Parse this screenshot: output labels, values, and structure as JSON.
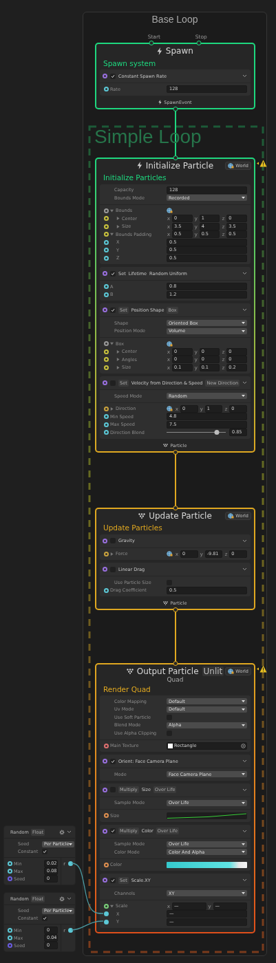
{
  "group": {
    "title": "Base Loop"
  },
  "subgroup": {
    "title": "Simple Loop"
  },
  "contexts": [
    {
      "kind": "spawn",
      "title": "Spawn",
      "inputs": [
        "Start",
        "Stop"
      ],
      "heading": "Spawn system",
      "color": "#1ed87f",
      "warning": false,
      "output": "SpawnEvent",
      "blocks": [
        {
          "checked": true,
          "title": [
            {
              "text": "Constant Spawn Rate",
              "chip": false
            }
          ],
          "sections": [
            [
              {
                "kind": "field",
                "label": "Rate",
                "value": "128",
                "color": "#5cc8d6"
              }
            ]
          ]
        }
      ]
    },
    {
      "kind": "init",
      "title": "Initialize Particle",
      "space": "World",
      "heading": "Initialize Particles",
      "color": "#1ed87f",
      "warning": true,
      "output": "Particle",
      "blocks": [
        {
          "sections": [
            [
              {
                "kind": "field",
                "label": "Capacity",
                "value": "128"
              },
              {
                "kind": "dropdown",
                "label": "Bounds Mode",
                "value": "Recorded"
              }
            ],
            [
              {
                "kind": "spaced",
                "label": "Bounds",
                "expanded": true,
                "color": "#9a9a9a",
                "children": [
                  {
                    "kind": "vector",
                    "label": "Center",
                    "expanded": false,
                    "color": "#c9c23e",
                    "components": [
                      {
                        "axis": "x",
                        "value": "0"
                      },
                      {
                        "axis": "y",
                        "value": "1"
                      },
                      {
                        "axis": "z",
                        "value": "0"
                      }
                    ]
                  },
                  {
                    "kind": "vector",
                    "label": "Size",
                    "expanded": false,
                    "color": "#c9c23e",
                    "components": [
                      {
                        "axis": "x",
                        "value": "3.5"
                      },
                      {
                        "axis": "y",
                        "value": "4"
                      },
                      {
                        "axis": "z",
                        "value": "3.5"
                      }
                    ]
                  }
                ]
              },
              {
                "kind": "vector",
                "label": "Bounds Padding",
                "expanded": true,
                "color": "#c9c23e",
                "components": [
                  {
                    "axis": "x",
                    "value": "0.5"
                  },
                  {
                    "axis": "y",
                    "value": "0.5"
                  },
                  {
                    "axis": "z",
                    "value": "0.5"
                  }
                ],
                "children": [
                  {
                    "kind": "field",
                    "label": "X",
                    "value": "0.5",
                    "color": "#5cc8d6"
                  },
                  {
                    "kind": "field",
                    "label": "Y",
                    "value": "0.5",
                    "color": "#5cc8d6"
                  },
                  {
                    "kind": "field",
                    "label": "Z",
                    "value": "0.5",
                    "color": "#5cc8d6"
                  }
                ]
              }
            ]
          ]
        },
        {
          "checked": true,
          "title": [
            {
              "text": "Set",
              "chip": false
            },
            {
              "text": "Lifetime",
              "chip": false
            },
            {
              "text": "Random Uniform",
              "chip": false
            }
          ],
          "sections": [
            [
              {
                "kind": "field",
                "label": "A",
                "value": "0.8",
                "color": "#5cc8d6"
              },
              {
                "kind": "field",
                "label": "B",
                "value": "1.2",
                "color": "#5cc8d6"
              }
            ]
          ]
        },
        {
          "checked": true,
          "title": [
            {
              "text": "Set",
              "chip": true
            },
            {
              "text": "Position Shape",
              "chip": false
            },
            {
              "text": "Box",
              "chip": true
            }
          ],
          "sections": [
            [
              {
                "kind": "dropdown",
                "label": "Shape",
                "value": "Oriented Box"
              },
              {
                "kind": "dropdown",
                "label": "Position Mode",
                "value": "Volume"
              }
            ],
            [
              {
                "kind": "spaced",
                "label": "Box",
                "expanded": true,
                "color": "#9a9a9a",
                "children": [
                  {
                    "kind": "vector",
                    "label": "Center",
                    "expanded": false,
                    "color": "#c9c23e",
                    "components": [
                      {
                        "axis": "x",
                        "value": "0"
                      },
                      {
                        "axis": "y",
                        "value": "0"
                      },
                      {
                        "axis": "z",
                        "value": "0"
                      }
                    ]
                  },
                  {
                    "kind": "vector",
                    "label": "Angles",
                    "expanded": false,
                    "color": "#c9c23e",
                    "components": [
                      {
                        "axis": "x",
                        "value": "0"
                      },
                      {
                        "axis": "y",
                        "value": "0"
                      },
                      {
                        "axis": "z",
                        "value": "0"
                      }
                    ]
                  },
                  {
                    "kind": "vector",
                    "label": "Size",
                    "expanded": false,
                    "color": "#c9c23e",
                    "components": [
                      {
                        "axis": "x",
                        "value": "0.1"
                      },
                      {
                        "axis": "y",
                        "value": "0.1"
                      },
                      {
                        "axis": "z",
                        "value": "0.2"
                      }
                    ]
                  }
                ]
              }
            ]
          ]
        },
        {
          "checked": false,
          "title": [
            {
              "text": "Set",
              "chip": true
            },
            {
              "text": "Velocity from Direction & Speed",
              "chip": false
            },
            {
              "text": "New Direction",
              "chip": true
            }
          ],
          "sections": [
            [
              {
                "kind": "dropdown",
                "label": "Speed Mode",
                "value": "Random"
              }
            ],
            [
              {
                "kind": "spaced",
                "label": "Direction",
                "expanded": false,
                "color": "#c9a23e",
                "components": [
                  {
                    "axis": "x",
                    "value": "0"
                  },
                  {
                    "axis": "y",
                    "value": "1"
                  },
                  {
                    "axis": "z",
                    "value": "0"
                  }
                ]
              },
              {
                "kind": "field",
                "label": "Min Speed",
                "value": "4.8",
                "color": "#5cc8d6"
              },
              {
                "kind": "field",
                "label": "Max Speed",
                "value": "7.5",
                "color": "#5cc8d6"
              },
              {
                "kind": "slider",
                "label": "Direction Blend",
                "level": 0.85,
                "value": "0.85",
                "color": "#5cc8d6"
              }
            ]
          ]
        }
      ]
    },
    {
      "kind": "update",
      "title": "Update Particle",
      "space": "World",
      "heading": "Update Particles",
      "color": "#e0a820",
      "warning": false,
      "output": "Particle",
      "blocks": [
        {
          "checked": false,
          "title": [
            {
              "text": "Gravity",
              "chip": false
            }
          ],
          "sections": [
            [
              {
                "kind": "spaced",
                "label": "Force",
                "expanded": false,
                "color": "#c9a23e",
                "components": [
                  {
                    "axis": "x",
                    "value": "0"
                  },
                  {
                    "axis": "y",
                    "value": "-9.81"
                  },
                  {
                    "axis": "z",
                    "value": "0"
                  }
                ]
              }
            ]
          ]
        },
        {
          "checked": false,
          "title": [
            {
              "text": "Linear Drag",
              "chip": false
            }
          ],
          "sections": [
            [
              {
                "kind": "toggle",
                "label": "Use Particle Size",
                "checked": false
              },
              {
                "kind": "field",
                "label": "Drag Coefficient",
                "value": "0.5",
                "color": "#5cc8d6"
              }
            ]
          ]
        }
      ]
    },
    {
      "kind": "output",
      "title": "Output Particle",
      "title_chip": "Unlit",
      "subtitle": "Quad",
      "space": "World",
      "heading": "Render Quad",
      "color": "#e0a820",
      "warning": true,
      "blocks": [
        {
          "sections": [
            [
              {
                "kind": "dropdown",
                "label": "Color Mapping",
                "value": "Default"
              },
              {
                "kind": "dropdown",
                "label": "Uv Mode",
                "value": "Default"
              },
              {
                "kind": "toggle",
                "label": "Use Soft Particle",
                "checked": false
              },
              {
                "kind": "dropdown",
                "label": "Blend Mode",
                "value": "Alpha"
              },
              {
                "kind": "toggle",
                "label": "Use Alpha Clipping",
                "checked": false
              }
            ],
            [
              {
                "kind": "texture",
                "label": "Main Texture",
                "value": "Rectangle",
                "color": "#e07070"
              }
            ]
          ]
        },
        {
          "checked": true,
          "title": [
            {
              "text": "Orient: Face Camera Plane",
              "chip": false
            }
          ],
          "sections": [
            [
              {
                "kind": "dropdown",
                "label": "Mode",
                "value": "Face Camera Plane"
              }
            ]
          ]
        },
        {
          "checked": false,
          "title": [
            {
              "text": "Multiply",
              "chip": true
            },
            {
              "text": "Size",
              "chip": false
            },
            {
              "text": "Over Life",
              "chip": true
            }
          ],
          "sections": [
            [
              {
                "kind": "dropdown",
                "label": "Sample Mode",
                "value": "Over Life"
              }
            ],
            [
              {
                "kind": "curve",
                "label": "Size",
                "color": "#e09050"
              }
            ]
          ]
        },
        {
          "checked": true,
          "title": [
            {
              "text": "Multiply",
              "chip": true
            },
            {
              "text": "Color",
              "chip": false
            },
            {
              "text": "Over Life",
              "chip": true
            }
          ],
          "sections": [
            [
              {
                "kind": "dropdown",
                "label": "Sample Mode",
                "value": "Over Life"
              },
              {
                "kind": "dropdown",
                "label": "Color Mode",
                "value": "Color And Alpha"
              }
            ],
            [
              {
                "kind": "gradient",
                "label": "Color",
                "color": "#e09050"
              }
            ]
          ]
        },
        {
          "checked": true,
          "title": [
            {
              "text": "Set",
              "chip": true
            },
            {
              "text": "Scale.XY",
              "chip": false
            }
          ],
          "sections": [
            [
              {
                "kind": "dropdown",
                "label": "Channels",
                "value": "XY"
              }
            ],
            [
              {
                "kind": "vector",
                "label": "Scale",
                "expanded": true,
                "color": "#7ad07a",
                "components": [
                  {
                    "axis": "x",
                    "value": "—"
                  },
                  {
                    "axis": "y",
                    "value": "—"
                  }
                ],
                "children": [
                  {
                    "kind": "field",
                    "label": "X",
                    "value": "—",
                    "color": "#5cc8d6",
                    "connected": true
                  },
                  {
                    "kind": "field",
                    "label": "Y",
                    "value": "—",
                    "color": "#5cc8d6",
                    "connected": true
                  }
                ]
              }
            ]
          ]
        }
      ]
    }
  ],
  "random_nodes": [
    {
      "title": "Random",
      "type": "Float",
      "settings": [
        {
          "kind": "dropdown",
          "label": "Seed",
          "value": "Per Particle"
        },
        {
          "kind": "toggle",
          "label": "Constant",
          "checked": true
        }
      ],
      "inputs": [
        {
          "label": "Min",
          "value": "0.02",
          "color": "#5cc8d6"
        },
        {
          "label": "Max",
          "value": "0.08",
          "color": "#5cc8d6"
        },
        {
          "label": "Seed",
          "value": "0",
          "color": "#6a5ce0"
        }
      ],
      "output": {
        "label": "r",
        "connected": true
      }
    },
    {
      "title": "Random",
      "type": "Float",
      "settings": [
        {
          "kind": "dropdown",
          "label": "Seed",
          "value": "Per Particle"
        },
        {
          "kind": "toggle",
          "label": "Constant",
          "checked": true
        }
      ],
      "inputs": [
        {
          "label": "Min",
          "value": "0",
          "color": "#5cc8d6"
        },
        {
          "label": "Max",
          "value": "0.04",
          "color": "#5cc8d6"
        },
        {
          "label": "Seed",
          "value": "0",
          "color": "#6a5ce0"
        }
      ],
      "output": {
        "label": "r",
        "connected": true
      }
    }
  ]
}
